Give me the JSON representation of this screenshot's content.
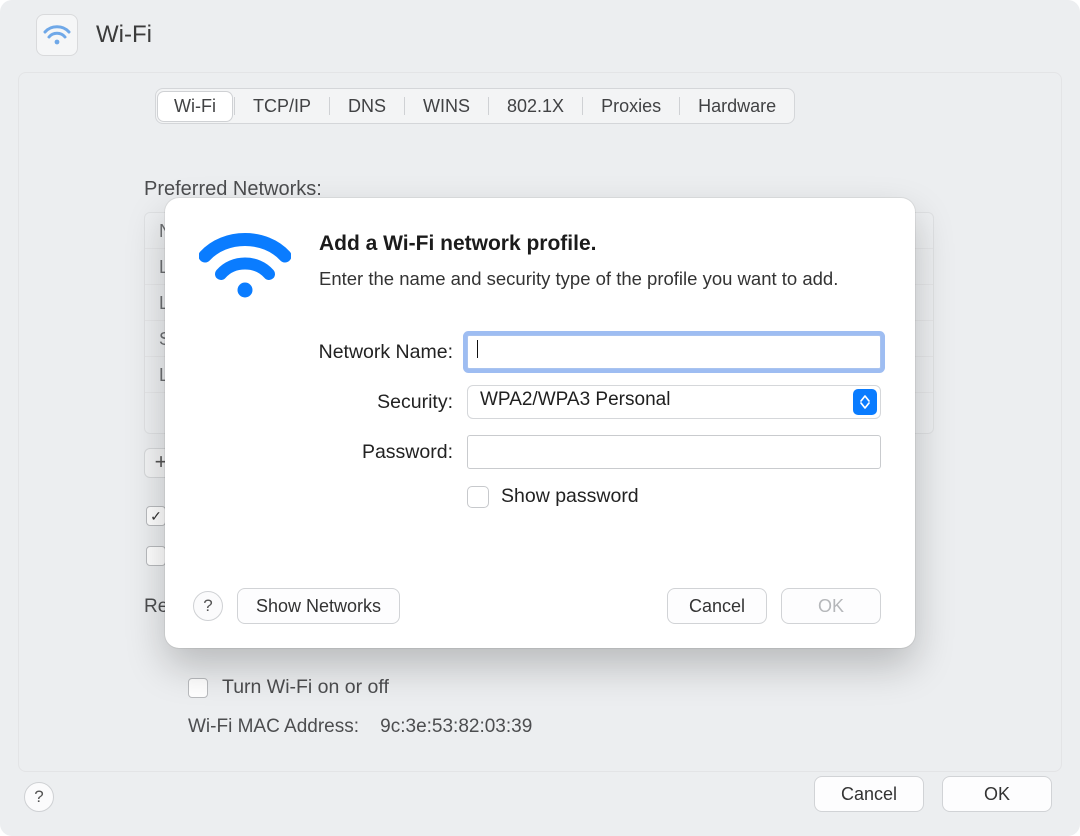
{
  "header": {
    "title": "Wi-Fi"
  },
  "tabs": {
    "items": [
      "Wi-Fi",
      "TCP/IP",
      "DNS",
      "WINS",
      "802.1X",
      "Proxies",
      "Hardware"
    ],
    "selected_index": 0
  },
  "background": {
    "preferred_label": "Preferred Networks:",
    "rows_initials": [
      "N",
      "L",
      "L",
      "S",
      "L"
    ],
    "add_button": "+",
    "auto_join_checked": true,
    "re_text_fragment": "Re",
    "turn_wifi_label": "Turn Wi-Fi on or off",
    "mac_label": "Wi-Fi MAC Address:",
    "mac_value": "9c:3e:53:82:03:39"
  },
  "footer": {
    "help": "?",
    "cancel": "Cancel",
    "ok": "OK"
  },
  "modal": {
    "title": "Add a Wi-Fi network profile.",
    "desc": "Enter the name and security type of the profile you want to add.",
    "network_name_label": "Network Name:",
    "network_name_value": "",
    "security_label": "Security:",
    "security_value": "WPA2/WPA3 Personal",
    "password_label": "Password:",
    "password_value": "",
    "show_password_label": "Show password",
    "show_password_checked": false,
    "help": "?",
    "show_networks": "Show Networks",
    "cancel": "Cancel",
    "ok": "OK",
    "ok_enabled": false
  }
}
